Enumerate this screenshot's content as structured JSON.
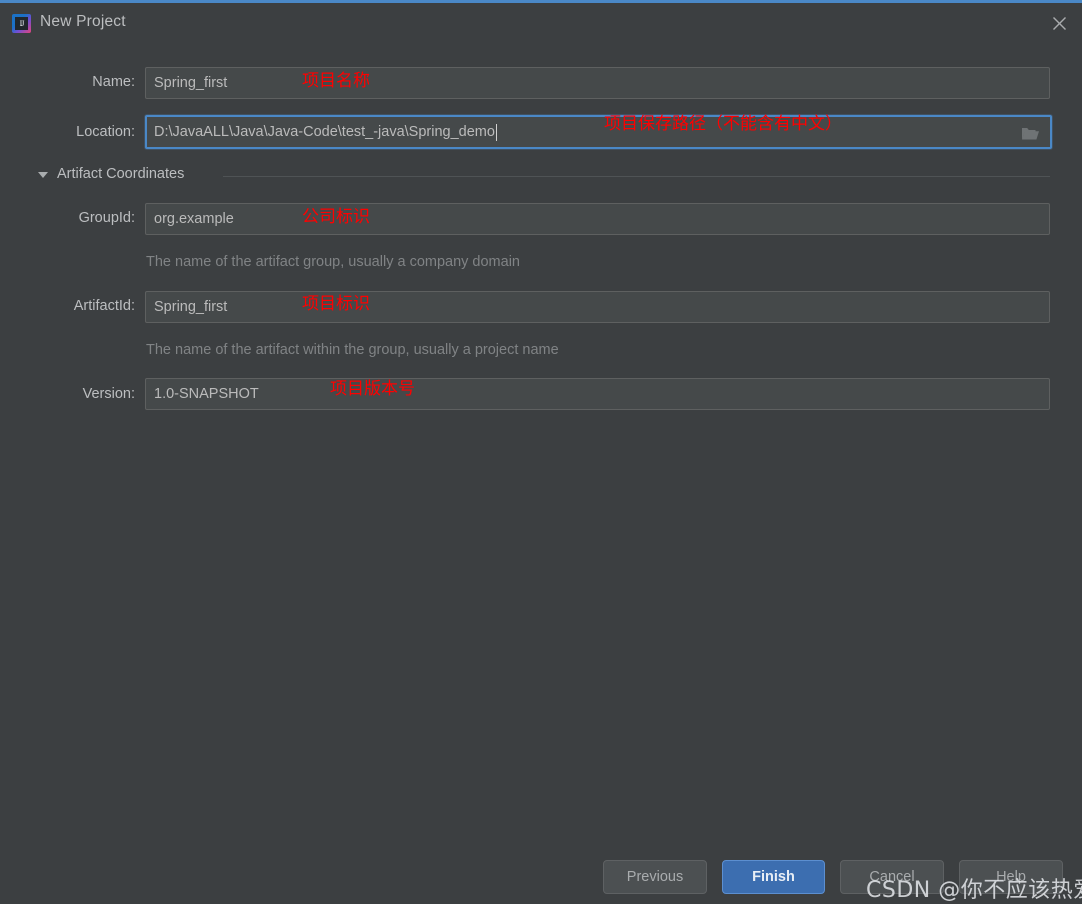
{
  "window": {
    "title": "New Project",
    "app_icon": "intellij-idea-icon",
    "close_icon": "close-icon",
    "accent_color": "#4a88c7",
    "background_color": "#3c3f41"
  },
  "form": {
    "name": {
      "label": "Name:",
      "value": "Spring_first",
      "annotation": "项目名称"
    },
    "location": {
      "label": "Location:",
      "value": "D:\\JavaALL\\Java\\Java-Code\\test_-java\\Spring_demo",
      "annotation": "项目保存路径（不能含有中文）",
      "browse_icon": "folder-icon"
    }
  },
  "section": {
    "title": "Artifact Coordinates",
    "expanded": true,
    "collapse_icon": "chevron-down-icon",
    "fields": {
      "group_id": {
        "label": "GroupId:",
        "value": "org.example",
        "annotation": "公司标识",
        "helper": "The name of the artifact group, usually a company domain"
      },
      "artifact_id": {
        "label": "ArtifactId:",
        "value": "Spring_first",
        "annotation": "项目标识",
        "helper": "The name of the artifact within the group, usually a project name"
      },
      "version": {
        "label": "Version:",
        "value": "1.0-SNAPSHOT",
        "annotation": "项目版本号"
      }
    }
  },
  "footer": {
    "previous_label": "Previous",
    "finish_label": "Finish",
    "cancel_label": "Cancel",
    "help_label": "Help",
    "primary_color": "#3c6eb0"
  },
  "watermark": {
    "text": "CSDN @你不应该热爱"
  }
}
